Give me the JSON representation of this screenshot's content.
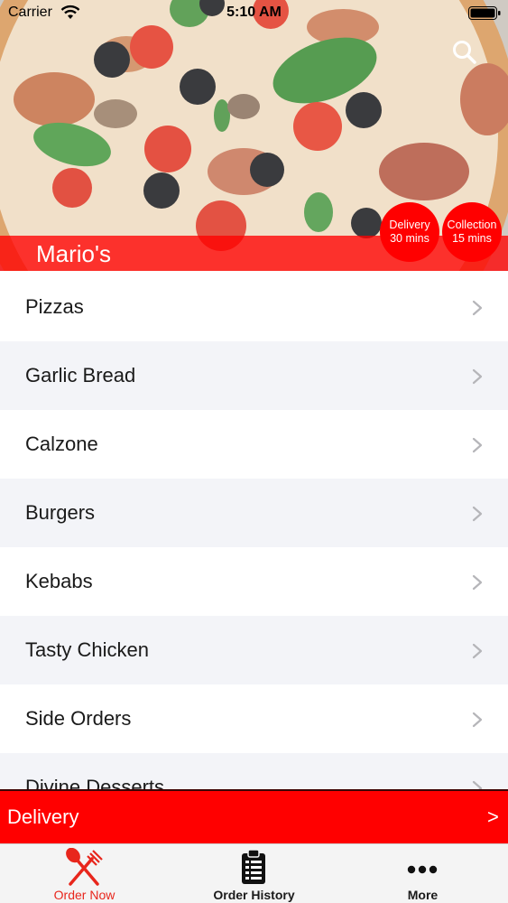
{
  "status_bar": {
    "carrier": "Carrier",
    "time": "5:10 AM"
  },
  "header": {
    "restaurant_name": "Mario's",
    "delivery_badge": {
      "label": "Delivery",
      "time": "30 mins"
    },
    "collection_badge": {
      "label": "Collection",
      "time": "15 mins"
    },
    "search_icon": "search-icon"
  },
  "menu": {
    "items": [
      {
        "label": "Pizzas"
      },
      {
        "label": "Garlic Bread"
      },
      {
        "label": "Calzone"
      },
      {
        "label": "Burgers"
      },
      {
        "label": "Kebabs"
      },
      {
        "label": "Tasty Chicken"
      },
      {
        "label": "Side Orders"
      },
      {
        "label": "Divine Desserts"
      }
    ]
  },
  "order_bar": {
    "label": "Delivery",
    "arrow": ">"
  },
  "tab_bar": {
    "tabs": [
      {
        "label": "Order Now",
        "icon": "fork-knife-icon",
        "active": true
      },
      {
        "label": "Order History",
        "icon": "clipboard-list-icon",
        "active": false
      },
      {
        "label": "More",
        "icon": "more-dots-icon",
        "active": false
      }
    ]
  },
  "colors": {
    "accent": "#ff0000",
    "active_tab": "#e8261c",
    "row_alt": "#f3f4f8"
  }
}
